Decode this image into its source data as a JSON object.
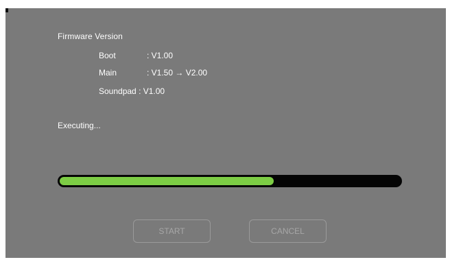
{
  "firmware": {
    "title": "Firmware Version",
    "rows": [
      {
        "label": "Boot",
        "value": ": V1.00"
      },
      {
        "label": "Main",
        "value": ": V1.50 → V2.00"
      },
      {
        "label": "Soundpad",
        "value": " : V1.00"
      }
    ]
  },
  "status": {
    "text": "Executing..."
  },
  "progress": {
    "fraction": 0.63,
    "fill_color": "#7dcd45",
    "track_color": "#050505"
  },
  "buttons": {
    "start_label": "START",
    "cancel_label": "CANCEL"
  },
  "colors": {
    "background": "#7a7a7a",
    "text": "#ffffff",
    "disabled_button_text": "#a7a7a7"
  }
}
